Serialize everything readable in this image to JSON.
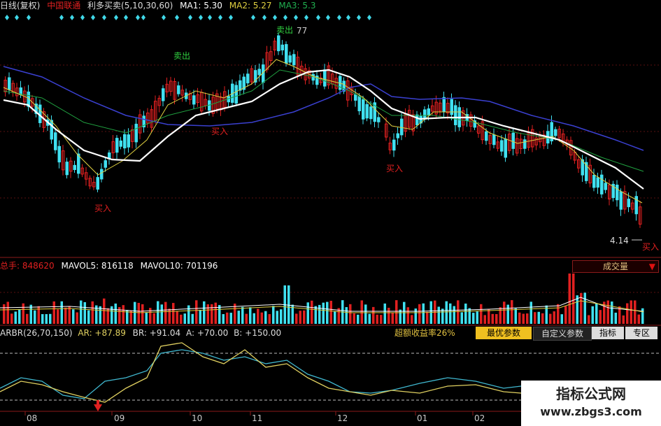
{
  "header": {
    "period": "日线(复权)",
    "stock": "中国联通",
    "indicator": "利多买卖(5,10,30,60)",
    "ma1": "MA1: 5.30",
    "ma2": "MA2: 5.27",
    "ma3": "MA3: 5.3"
  },
  "signals": {
    "sell1": "卖出",
    "sell2": "卖出",
    "buy1": "买入",
    "buy2": "买入",
    "buy3": "买入",
    "buy4": "买入",
    "peak_label": "77",
    "low_label": "4.14"
  },
  "volume_header": {
    "total_label": "总手:",
    "total_value": "848620",
    "mavol5": "MAVOL5: 816118",
    "mavol10": "MAVOL10: 701196",
    "selector": "成交量"
  },
  "arbr_header": {
    "name": "ARBR(26,70,150)",
    "ar": "AR: +87.89",
    "br": "BR: +91.04",
    "a": "A: +70.00",
    "b": "B: +150.00",
    "excess": "超额收益率26%"
  },
  "buttons": {
    "best": "最优参数",
    "custom": "自定义参数",
    "indicator": "指标",
    "zone": "专区"
  },
  "months": [
    "08",
    "09",
    "10",
    "11",
    "12",
    "01",
    "02"
  ],
  "watermark": {
    "line1": "指标公式网",
    "line2": "www.zbgs3.com"
  },
  "colors": {
    "up": "#e02020",
    "down": "#40e0f0",
    "ma_white": "#ffffff",
    "ma_yellow": "#e0d040",
    "ma_green": "#20a040",
    "ma_blue": "#3a40d0",
    "ar_line": "#e0d060",
    "br_line": "#40b8d0"
  },
  "chart_data": [
    {
      "type": "candlestick",
      "title": "利多买卖(5,10,30,60)",
      "series": [
        {
          "name": "MA1",
          "last": 5.3
        },
        {
          "name": "MA2",
          "last": 5.27
        },
        {
          "name": "MA3",
          "last": 5.3
        }
      ],
      "annotations": [
        "卖出",
        "卖出",
        "买入",
        "买入",
        "买入",
        "买入",
        "4.14"
      ],
      "months": [
        "08",
        "09",
        "10",
        "11",
        "12",
        "01",
        "02"
      ]
    },
    {
      "type": "bar",
      "title": "成交量",
      "total": 848620,
      "series": [
        {
          "name": "MAVOL5",
          "last": 816118
        },
        {
          "name": "MAVOL10",
          "last": 701196
        }
      ]
    },
    {
      "type": "line",
      "title": "ARBR(26,70,150)",
      "series": [
        {
          "name": "AR",
          "last": 87.89
        },
        {
          "name": "BR",
          "last": 91.04
        }
      ],
      "reference_lines": [
        {
          "name": "A",
          "value": 70.0
        },
        {
          "name": "B",
          "value": 150.0
        }
      ]
    }
  ]
}
